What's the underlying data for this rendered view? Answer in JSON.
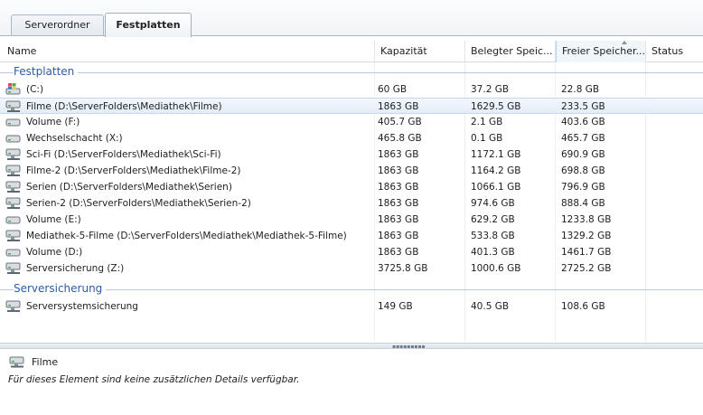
{
  "tabs": [
    {
      "label": "Serverordner",
      "active": false
    },
    {
      "label": "Festplatten",
      "active": true
    }
  ],
  "columns": {
    "name": "Name",
    "capacity": "Kapazität",
    "used": "Belegter Speic...",
    "free": "Freier Speicher...",
    "status": "Status"
  },
  "groups": [
    {
      "label": "Festplatten",
      "rows": [
        {
          "name": "(C:)",
          "capacity": "60 GB",
          "used": "37.2 GB",
          "free": "22.8 GB",
          "icon": "windows-drive-icon",
          "selected": false
        },
        {
          "name": "Filme (D:\\ServerFolders\\Mediathek\\Filme)",
          "capacity": "1863 GB",
          "used": "1629.5 GB",
          "free": "233.5 GB",
          "icon": "shared-drive-icon",
          "selected": true
        },
        {
          "name": "Volume (F:)",
          "capacity": "405.7 GB",
          "used": "2.1 GB",
          "free": "403.6 GB",
          "icon": "drive-icon",
          "selected": false
        },
        {
          "name": "Wechselschacht (X:)",
          "capacity": "465.8 GB",
          "used": "0.1 GB",
          "free": "465.7 GB",
          "icon": "drive-icon",
          "selected": false
        },
        {
          "name": "Sci-Fi (D:\\ServerFolders\\Mediathek\\Sci-Fi)",
          "capacity": "1863 GB",
          "used": "1172.1 GB",
          "free": "690.9 GB",
          "icon": "shared-drive-icon",
          "selected": false
        },
        {
          "name": "Filme-2 (D:\\ServerFolders\\Mediathek\\Filme-2)",
          "capacity": "1863 GB",
          "used": "1164.2 GB",
          "free": "698.8 GB",
          "icon": "shared-drive-icon",
          "selected": false
        },
        {
          "name": "Serien (D:\\ServerFolders\\Mediathek\\Serien)",
          "capacity": "1863 GB",
          "used": "1066.1 GB",
          "free": "796.9 GB",
          "icon": "shared-drive-icon",
          "selected": false
        },
        {
          "name": "Serien-2 (D:\\ServerFolders\\Mediathek\\Serien-2)",
          "capacity": "1863 GB",
          "used": "974.6 GB",
          "free": "888.4 GB",
          "icon": "shared-drive-icon",
          "selected": false
        },
        {
          "name": "Volume (E:)",
          "capacity": "1863 GB",
          "used": "629.2 GB",
          "free": "1233.8 GB",
          "icon": "drive-icon",
          "selected": false
        },
        {
          "name": "Mediathek-5-Filme (D:\\ServerFolders\\Mediathek\\Mediathek-5-Filme)",
          "capacity": "1863 GB",
          "used": "533.8 GB",
          "free": "1329.2 GB",
          "icon": "shared-drive-icon",
          "selected": false
        },
        {
          "name": "Volume (D:)",
          "capacity": "1863 GB",
          "used": "401.3 GB",
          "free": "1461.7 GB",
          "icon": "drive-icon",
          "selected": false
        },
        {
          "name": "Serversicherung (Z:)",
          "capacity": "3725.8 GB",
          "used": "1000.6 GB",
          "free": "2725.2 GB",
          "icon": "shared-drive-icon",
          "selected": false
        }
      ]
    },
    {
      "label": "Serversicherung",
      "rows": [
        {
          "name": "Serversystemsicherung",
          "capacity": "149 GB",
          "used": "40.5 GB",
          "free": "108.6 GB",
          "icon": "shared-drive-icon",
          "selected": false
        }
      ]
    }
  ],
  "details": {
    "title": "Filme",
    "text": "Für dieses Element sind keine zusätzlichen Details verfügbar.",
    "icon": "shared-drive-icon"
  },
  "colors": {
    "group_header": "#2c5ca8",
    "selection": "#e3edf8",
    "border": "#aab7c6"
  }
}
